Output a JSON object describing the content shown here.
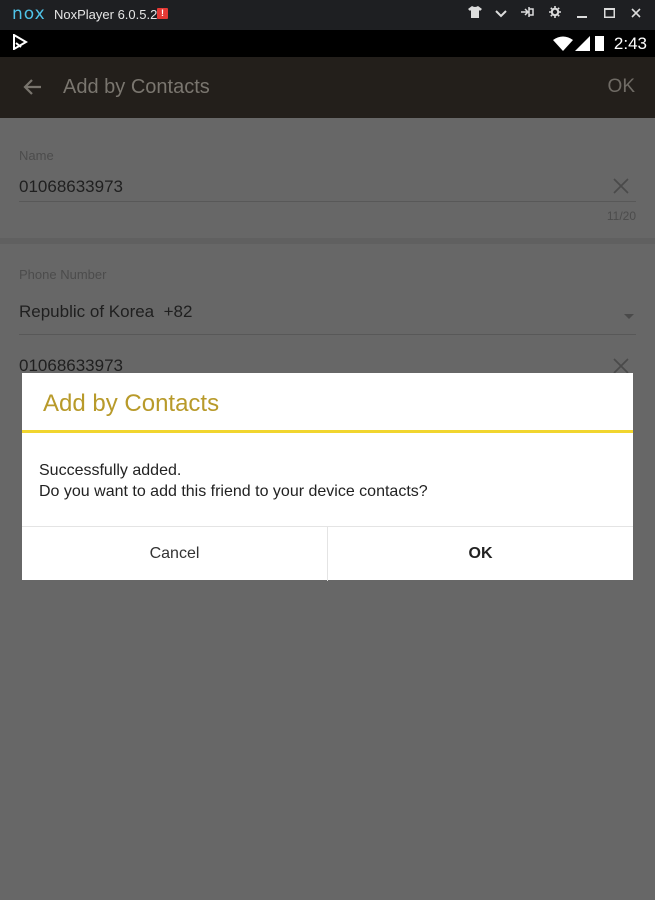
{
  "emulator": {
    "logo": "nox",
    "title": "NoxPlayer 6.0.5.2",
    "badge": "!",
    "controls": [
      "shirt-icon",
      "chevron-down-icon",
      "pin-icon",
      "gear-icon",
      "minimize-icon",
      "maximize-icon",
      "close-icon"
    ]
  },
  "status_bar": {
    "time": "2:43",
    "icons": [
      "notification-icon",
      "wifi-icon",
      "signal-icon",
      "battery-icon"
    ]
  },
  "app_bar": {
    "title": "Add by Contacts",
    "ok_label": "OK"
  },
  "form": {
    "name_label": "Name",
    "name_value": "01068633973",
    "name_counter": "11/20",
    "phone_label": "Phone Number",
    "country_value": "Republic of Korea  +82",
    "phone_value": "01068633973"
  },
  "dialog": {
    "title": "Add by Contacts",
    "message_line1": "Successfully added.",
    "message_line2": "Do you want to add this friend to your device contacts?",
    "cancel_label": "Cancel",
    "ok_label": "OK"
  },
  "colors": {
    "dialog_title": "#b89a2a",
    "dialog_rule": "#f1d52e",
    "app_bar": "#231f1b",
    "overlay_dim": "#676767"
  }
}
